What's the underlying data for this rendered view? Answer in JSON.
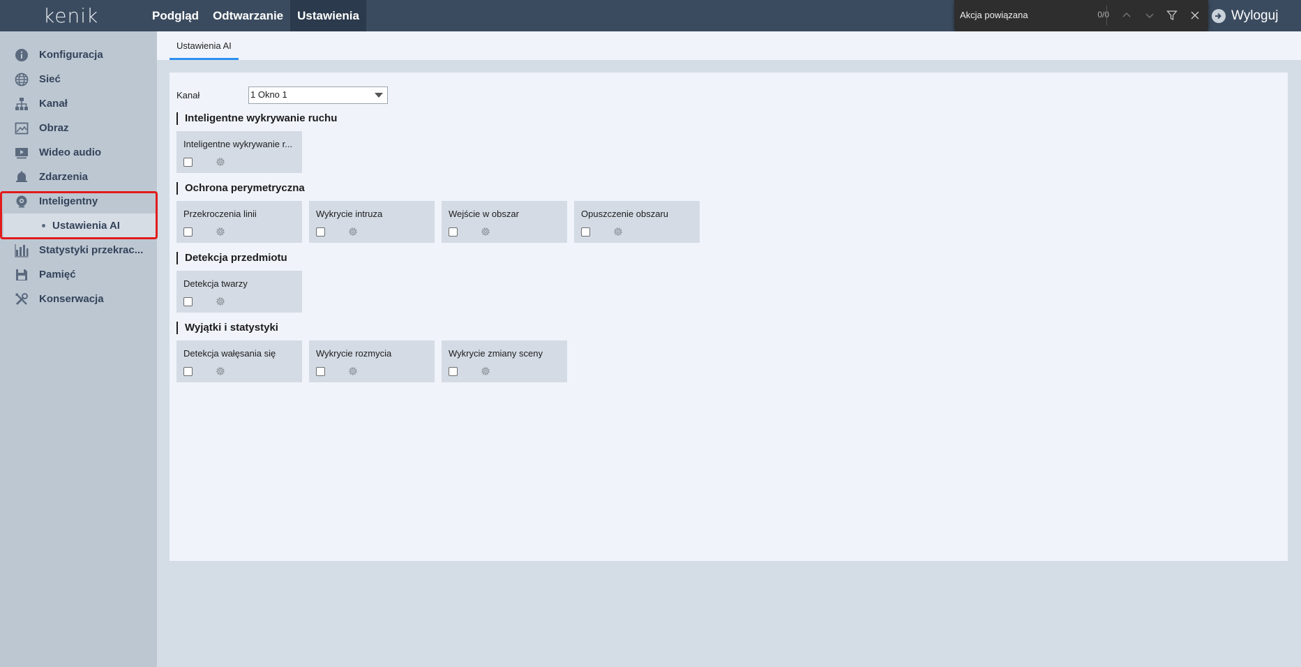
{
  "app": {
    "logo": "kenik"
  },
  "nav": {
    "items": [
      "Podgląd",
      "Odtwarzanie",
      "Ustawienia"
    ],
    "active": "Ustawienia"
  },
  "logout": {
    "label": "Wyloguj"
  },
  "findbar": {
    "query": "Akcja powiązana",
    "count": "0/0"
  },
  "sidebar": {
    "items": [
      {
        "label": "Konfiguracja",
        "icon": "info-icon"
      },
      {
        "label": "Sieć",
        "icon": "globe-icon"
      },
      {
        "label": "Kanał",
        "icon": "network-tree-icon"
      },
      {
        "label": "Obraz",
        "icon": "image-icon"
      },
      {
        "label": "Wideo audio",
        "icon": "video-icon"
      },
      {
        "label": "Zdarzenia",
        "icon": "bell-icon"
      },
      {
        "label": "Inteligentny",
        "icon": "ai-camera-icon"
      },
      {
        "label": "Statystyki przekrac...",
        "icon": "bar-chart-icon"
      },
      {
        "label": "Pamięć",
        "icon": "save-icon"
      },
      {
        "label": "Konserwacja",
        "icon": "tools-icon"
      }
    ],
    "sub_item": "Ustawienia AI"
  },
  "tabs": {
    "active": "Ustawienia AI"
  },
  "form": {
    "kanal_label": "Kanał",
    "kanal_value": "1 Okno 1"
  },
  "sections": [
    {
      "title": "Inteligentne wykrywanie ruchu",
      "cards": [
        "Inteligentne wykrywanie r..."
      ]
    },
    {
      "title": "Ochrona perymetryczna",
      "cards": [
        "Przekroczenia linii",
        "Wykrycie intruza",
        "Wejście w obszar",
        "Opuszczenie obszaru"
      ]
    },
    {
      "title": "Detekcja przedmiotu",
      "cards": [
        "Detekcja twarzy"
      ]
    },
    {
      "title": "Wyjątki i statystyki",
      "cards": [
        "Detekcja wałęsania się",
        "Wykrycie rozmycia",
        "Wykrycie zmiany sceny"
      ]
    }
  ],
  "colors": {
    "topbar": "#3b4b5f",
    "sidebar": "#bdc7d2",
    "accent": "#2d8ff0",
    "highlight": "#e11b1b"
  }
}
